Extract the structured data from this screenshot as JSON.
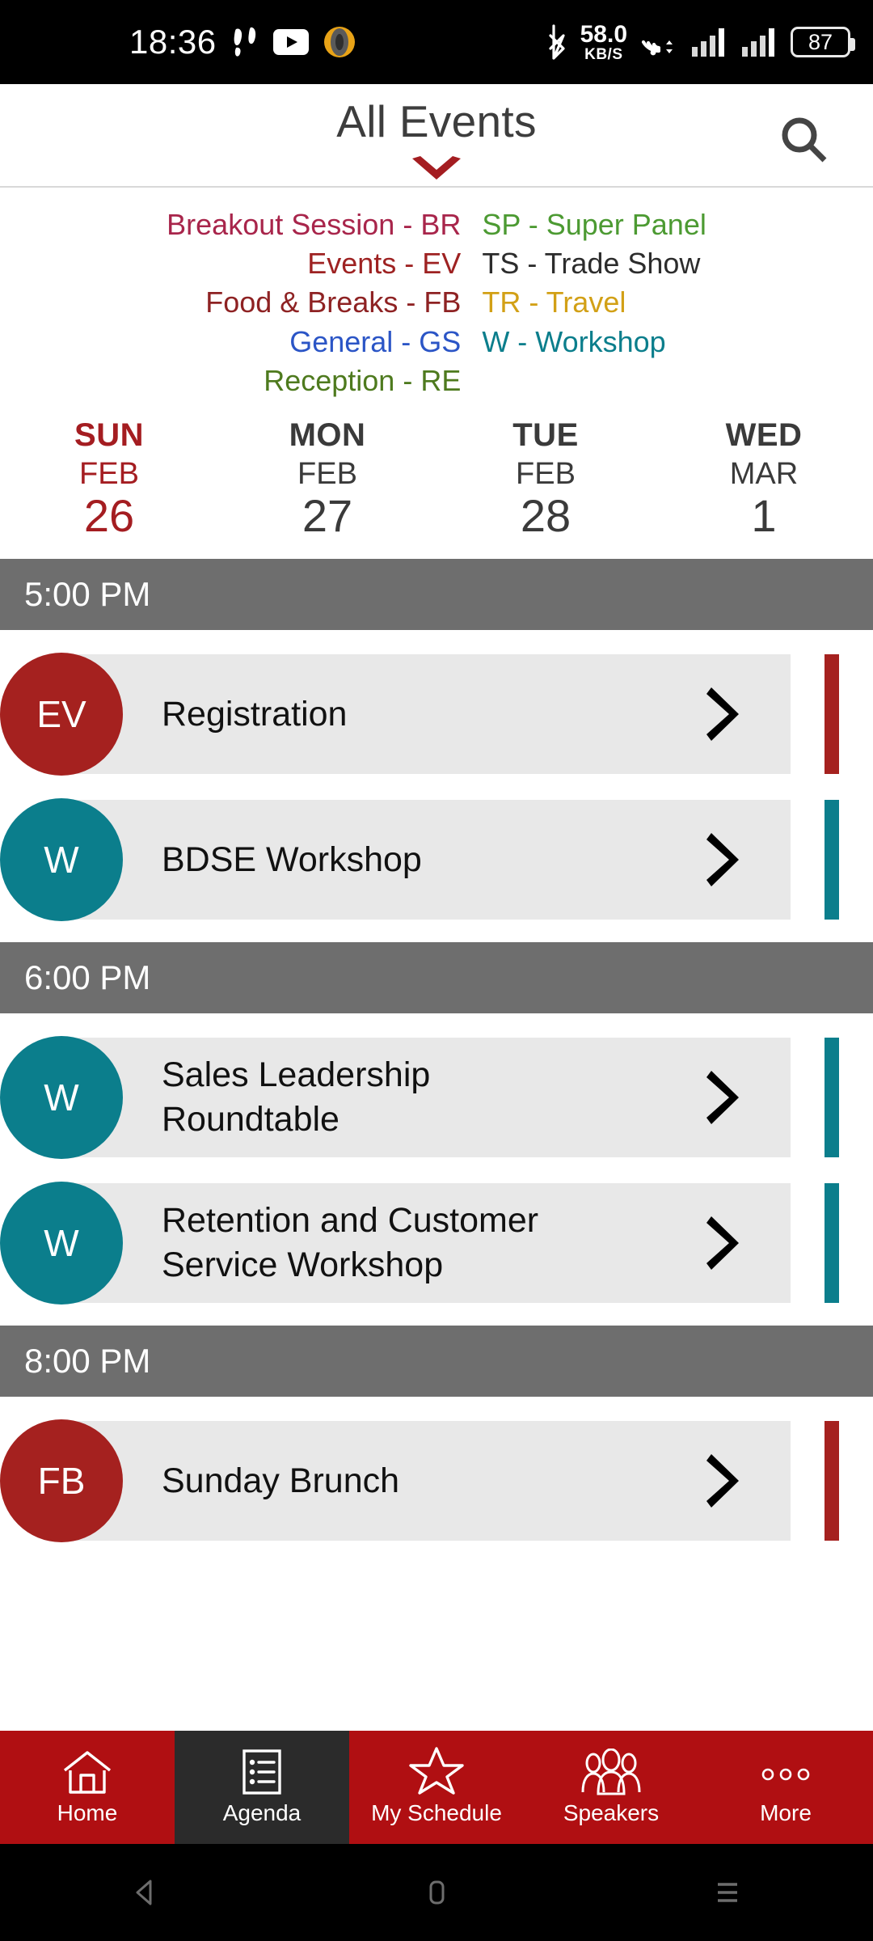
{
  "status_bar": {
    "clock": "18:36",
    "icons": [
      "footsteps-icon",
      "youtube-icon",
      "portal-icon",
      "bluetooth-icon"
    ],
    "net_speed_value": "58.0",
    "net_speed_unit": "KB/S",
    "battery_level": "87"
  },
  "app_bar": {
    "title": "All Events",
    "chevron": "chevron-down-icon",
    "search": "search-icon",
    "accent_red": "#A41D21"
  },
  "legend": {
    "left": [
      {
        "text": "Breakout Session - BR",
        "color": "#A8254B"
      },
      {
        "text": "Events - EV",
        "color": "#9E2222"
      },
      {
        "text": "Food & Breaks - FB",
        "color": "#8E2223"
      },
      {
        "text": "General - GS",
        "color": "#2B55C6"
      },
      {
        "text": "Reception - RE",
        "color": "#4E7A1E"
      }
    ],
    "right": [
      {
        "text": "SP - Super Panel",
        "color": "#4C9A32"
      },
      {
        "text": "TS - Trade Show",
        "color": "#2C2C2C"
      },
      {
        "text": "TR - Travel",
        "color": "#D2A016"
      },
      {
        "text": "W - Workshop",
        "color": "#0B7E8C"
      }
    ]
  },
  "date_tabs": [
    {
      "dow": "SUN",
      "month": "FEB",
      "day": "26",
      "selected": true
    },
    {
      "dow": "MON",
      "month": "FEB",
      "day": "27",
      "selected": false
    },
    {
      "dow": "TUE",
      "month": "FEB",
      "day": "28",
      "selected": false
    },
    {
      "dow": "WED",
      "month": "MAR",
      "day": "1",
      "selected": false
    }
  ],
  "agenda": [
    {
      "time": "5:00 PM",
      "events": [
        {
          "code": "EV",
          "title": "Registration",
          "color": "#A5211F"
        },
        {
          "code": "W",
          "title": "BDSE Workshop",
          "color": "#0B7E8C"
        }
      ]
    },
    {
      "time": "6:00 PM",
      "events": [
        {
          "code": "W",
          "title": "Sales Leadership Roundtable",
          "color": "#0B7E8C"
        },
        {
          "code": "W",
          "title": "Retention and Customer Service Workshop",
          "color": "#0B7E8C"
        }
      ]
    },
    {
      "time": "8:00 PM",
      "events": [
        {
          "code": "FB",
          "title": "Sunday Brunch",
          "color": "#A5211F"
        }
      ]
    }
  ],
  "bottom_nav": {
    "background": "#B00F12",
    "active_background": "#2b2b2b",
    "items": [
      {
        "label": "Home",
        "icon": "home-icon",
        "active": false
      },
      {
        "label": "Agenda",
        "icon": "list-icon",
        "active": true
      },
      {
        "label": "My Schedule",
        "icon": "star-icon",
        "active": false
      },
      {
        "label": "Speakers",
        "icon": "people-icon",
        "active": false
      },
      {
        "label": "More",
        "icon": "more-dots-icon",
        "active": false
      }
    ]
  },
  "android_nav": {
    "back": "back-triangle-icon",
    "home": "home-square-icon",
    "recents": "recents-lines-icon"
  }
}
